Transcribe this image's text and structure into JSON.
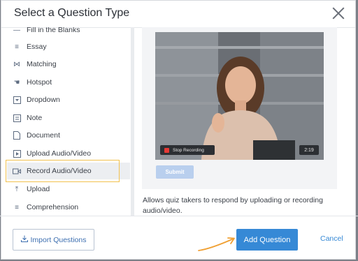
{
  "dialog": {
    "title": "Select a Question Type"
  },
  "sidebar": {
    "items": [
      {
        "label": "Fill in the Blanks",
        "icon": "blanks-icon"
      },
      {
        "label": "Essay",
        "icon": "lines-icon"
      },
      {
        "label": "Matching",
        "icon": "matching-icon"
      },
      {
        "label": "Hotspot",
        "icon": "hotspot-icon"
      },
      {
        "label": "Dropdown",
        "icon": "dropdown-icon"
      },
      {
        "label": "Note",
        "icon": "note-icon"
      },
      {
        "label": "Document",
        "icon": "document-icon"
      },
      {
        "label": "Upload Audio/Video",
        "icon": "play-icon"
      },
      {
        "label": "Record Audio/Video",
        "icon": "camera-icon",
        "selected": true
      },
      {
        "label": "Upload",
        "icon": "upload-icon"
      },
      {
        "label": "Comprehension",
        "icon": "lines-icon"
      }
    ]
  },
  "preview": {
    "stop_label": "Stop Recording",
    "timer": "2:19",
    "submit_label": "Submit",
    "description": "Allows quiz takers to respond by uploading or recording audio/video."
  },
  "footer": {
    "import_label": "Import Questions",
    "add_label": "Add Question",
    "cancel_label": "Cancel"
  },
  "colors": {
    "accent": "#3689d6",
    "highlight": "#f2c14e",
    "arrow": "#f0a033"
  }
}
